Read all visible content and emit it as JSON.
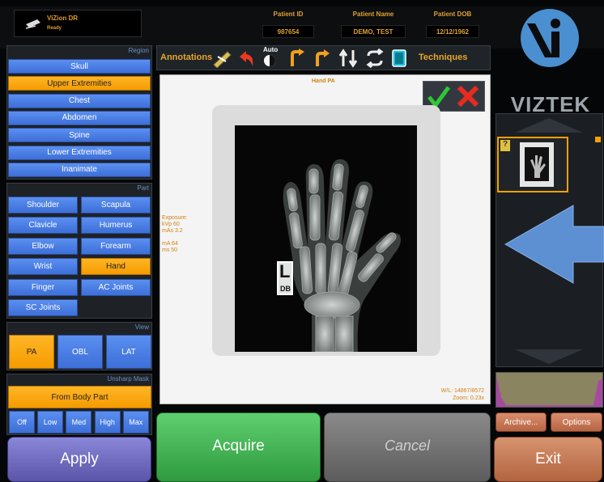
{
  "app": {
    "name": "ViZion DR",
    "status": "Ready"
  },
  "patient": {
    "id_label": "Patient ID",
    "id_value": "987654",
    "name_label": "Patient Name",
    "name_value": "DEMO, TEST",
    "dob_label": "Patient DOB",
    "dob_value": "12/12/1962"
  },
  "brand": {
    "name": "VIZTEK"
  },
  "region": {
    "title": "Region",
    "items": [
      "Skull",
      "Upper Extremities",
      "Chest",
      "Abdomen",
      "Spine",
      "Lower Extremities",
      "Inanimate"
    ],
    "selected": "Upper Extremities"
  },
  "part": {
    "title": "Part",
    "items": [
      "Shoulder",
      "Scapula",
      "Clavicle",
      "Humerus",
      "Elbow",
      "Forearm",
      "Wrist",
      "Hand",
      "Finger",
      "AC Joints",
      "SC Joints"
    ],
    "selected": "Hand"
  },
  "view": {
    "title": "View",
    "items": [
      "PA",
      "OBL",
      "LAT"
    ],
    "selected": "PA"
  },
  "unsharp": {
    "title": "Unsharp Mask",
    "mode": "From Body Part",
    "levels": [
      "Off",
      "Low",
      "Med",
      "High",
      "Max"
    ]
  },
  "toolbar": {
    "annotations": "Annotations",
    "techniques": "Techniques",
    "auto": "Auto"
  },
  "image": {
    "label": "Hand PA",
    "exposure": [
      "Exposure:",
      "kVp 60",
      "mAs 3.2",
      "",
      "mA 64",
      "ms 50"
    ],
    "wl": "W/L: 14867/8572",
    "zoom": "Zoom: 0.23x",
    "marker_letter": "L",
    "marker_initials": "DB"
  },
  "thumb": {
    "badge": "?"
  },
  "actions": {
    "apply": "Apply",
    "acquire": "Acquire",
    "cancel": "Cancel",
    "archive": "Archive...",
    "options": "Options",
    "exit": "Exit"
  }
}
